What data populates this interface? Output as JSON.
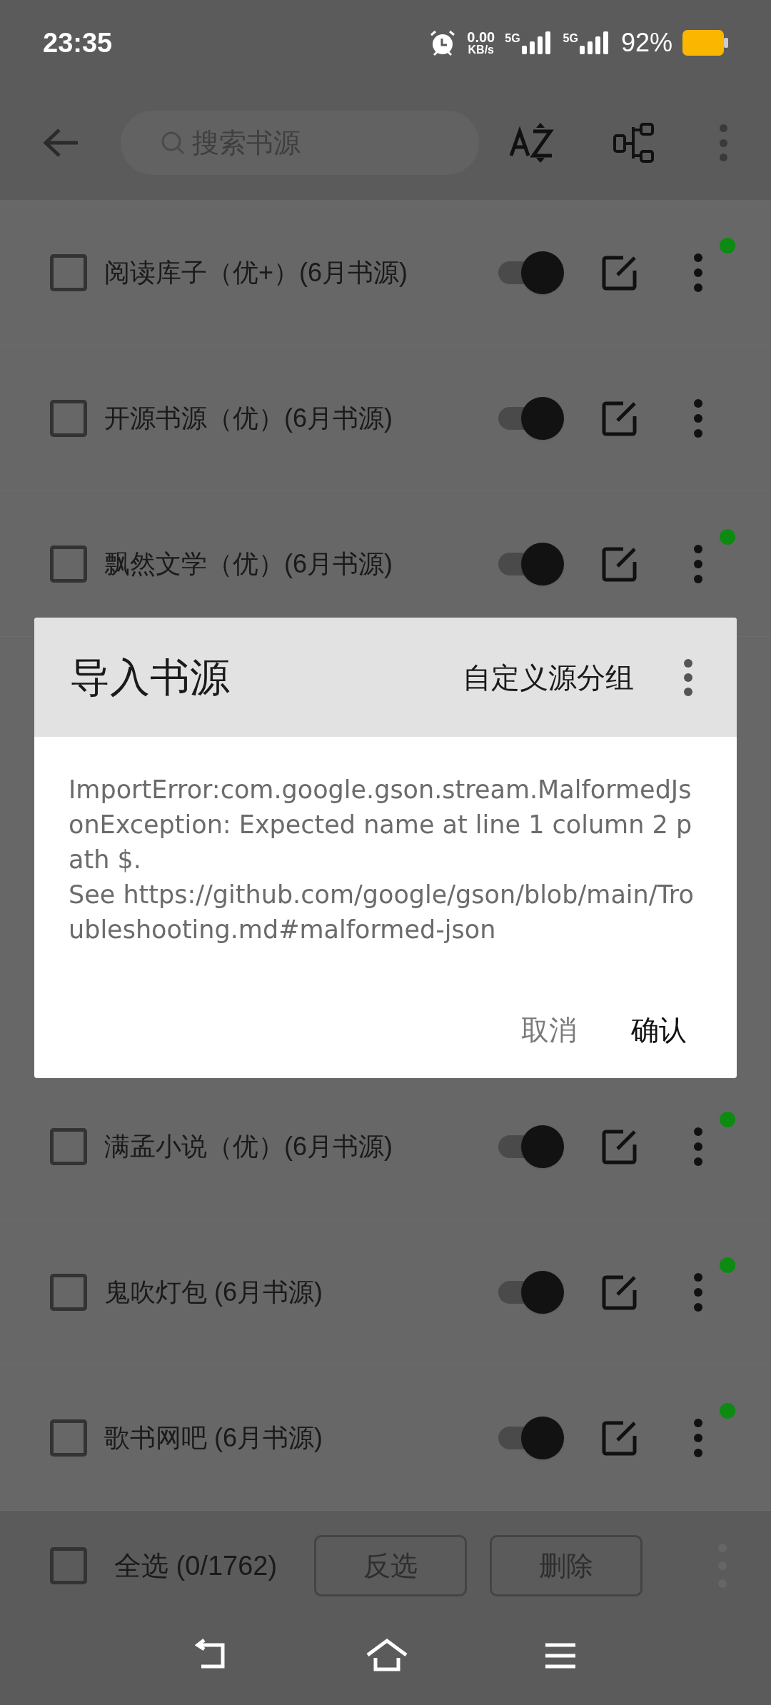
{
  "status_bar": {
    "time": "23:35",
    "net_speed": "0.00",
    "net_unit": "KB/s",
    "sim_1": "5G",
    "sim_2": "5G",
    "battery": "92%"
  },
  "toolbar": {
    "search": {
      "placeholder": "搜索书源"
    }
  },
  "sources_above": [
    {
      "name": "阅读库子（优+）(6月书源)",
      "checked": false,
      "enabled": true,
      "status_dot": true
    },
    {
      "name": "开源书源（优）(6月书源)",
      "checked": false,
      "enabled": true,
      "status_dot": false
    },
    {
      "name": "飘然文学（优）(6月书源)",
      "checked": false,
      "enabled": true,
      "status_dot": true
    }
  ],
  "sources_below": [
    {
      "name": "满孟小说（优）(6月书源)",
      "checked": false,
      "enabled": true,
      "status_dot": true
    },
    {
      "name": "鬼吹灯包 (6月书源)",
      "checked": false,
      "enabled": true,
      "status_dot": true
    },
    {
      "name": "歌书网吧 (6月书源)",
      "checked": false,
      "enabled": true,
      "status_dot": true
    }
  ],
  "dialog": {
    "title": "导入书源",
    "group_button": "自定义源分组",
    "message": "ImportError:com.google.gson.stream.MalformedJsonException: Expected name at line 1 column 2 path $.\nSee https://github.com/google/gson/blob/main/Troubleshooting.md#malformed-json",
    "cancel": "取消",
    "confirm": "确认"
  },
  "bottom_bar": {
    "select_all": {
      "label": "全选 (0/1762)",
      "checked": false
    },
    "buttons": [
      "反选",
      "删除"
    ]
  }
}
